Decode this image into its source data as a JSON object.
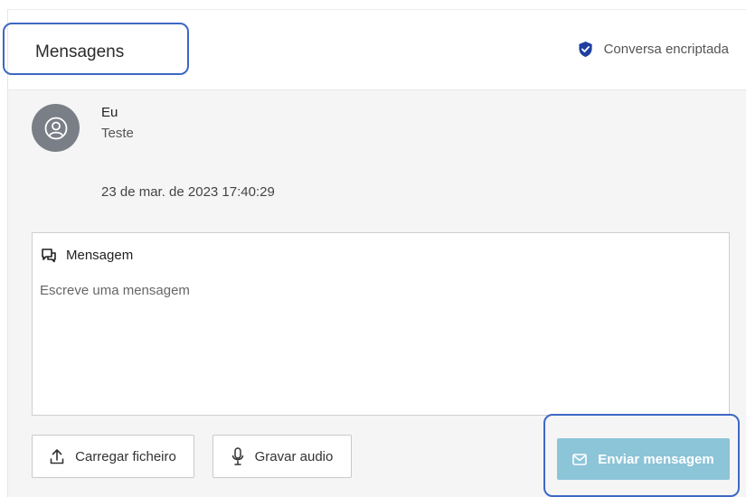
{
  "header": {
    "title": "Mensagens",
    "security_label": "Conversa encriptada",
    "security_icon": "shield-check-icon",
    "security_color": "#1f3fa0"
  },
  "message": {
    "author": "Eu",
    "text": "Teste",
    "timestamp": "23 de mar. de 2023 17:40:29",
    "avatar_icon": "user-circle-icon"
  },
  "composer": {
    "label": "Mensagem",
    "label_icon": "chat-bubbles-icon",
    "placeholder": "Escreve uma mensagem"
  },
  "actions": {
    "upload_label": "Carregar ficheiro",
    "upload_icon": "upload-icon",
    "record_label": "Gravar audio",
    "record_icon": "microphone-icon",
    "send_label": "Enviar mensagem",
    "send_icon": "envelope-icon",
    "send_color": "#8cc4d8"
  },
  "accent_color": "#3d68c4"
}
